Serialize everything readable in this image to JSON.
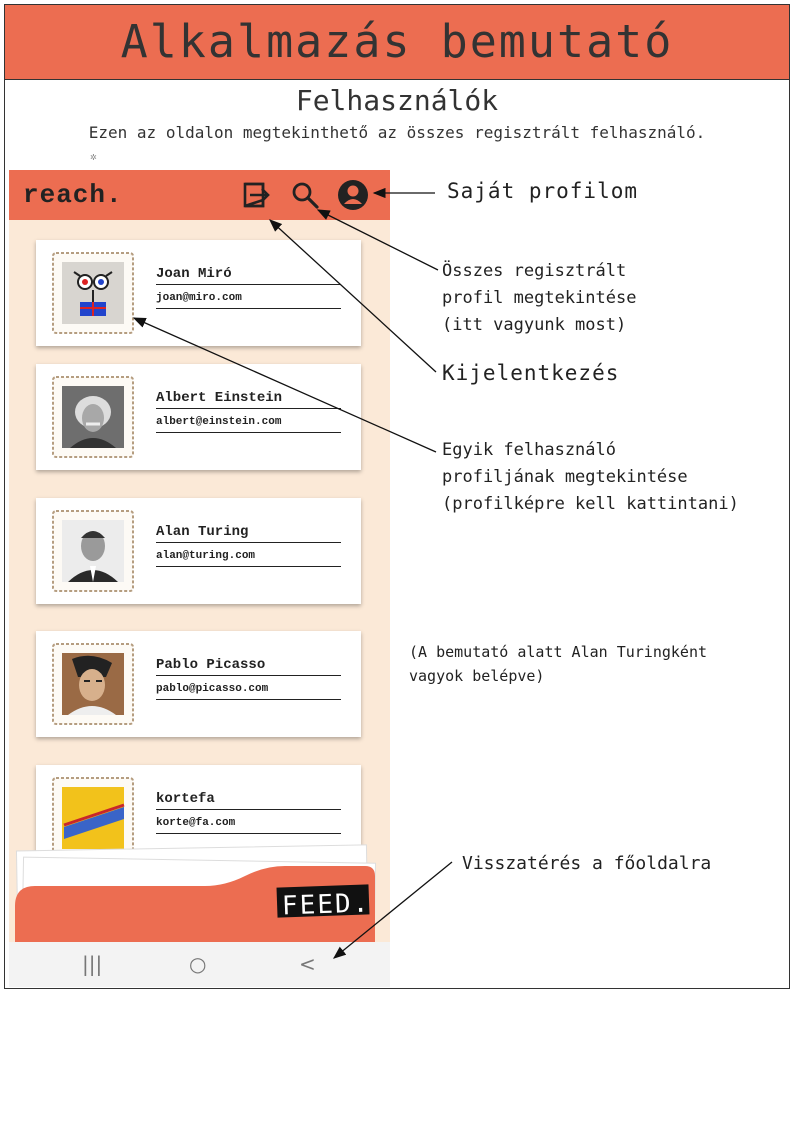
{
  "banner": {
    "title": "Alkalmazás bemutató"
  },
  "page": {
    "title": "Felhasználók",
    "description": "Ezen az oldalon megtekinthető az összes regisztrált felhasználó."
  },
  "app": {
    "brand": "reach.",
    "icons": {
      "logout": "logout-icon",
      "search": "search-icon",
      "profile": "account-circle-icon"
    },
    "users": [
      {
        "name": "Joan Miró",
        "email": "joan@miro.com"
      },
      {
        "name": "Albert Einstein",
        "email": "albert@einstein.com"
      },
      {
        "name": "Alan Turing",
        "email": "alan@turing.com"
      },
      {
        "name": "Pablo Picasso",
        "email": "pablo@picasso.com"
      },
      {
        "name": "kortefa",
        "email": "korte@fa.com"
      }
    ],
    "feed_label": "FEED.",
    "nav": {
      "recents": "|||",
      "home": "○",
      "back": "<"
    }
  },
  "annotations": {
    "profile": "Saját profilom",
    "all_profiles": [
      "Összes regisztrált",
      "profil megtekintése",
      "(itt vagyunk most)"
    ],
    "logout": "Kijelentkezés",
    "user_profile": [
      "Egyik felhasználó",
      "profiljának megtekintése",
      "(profilképre kell kattintani)"
    ],
    "logged_in_note": [
      "(A bemutató alatt Alan Turingként",
      "vagyok belépve)"
    ],
    "back_home": "Visszatérés a főoldalra"
  },
  "colors": {
    "accent": "#ec6d51",
    "phone_bg": "#fbe9d7",
    "text": "#222222"
  }
}
